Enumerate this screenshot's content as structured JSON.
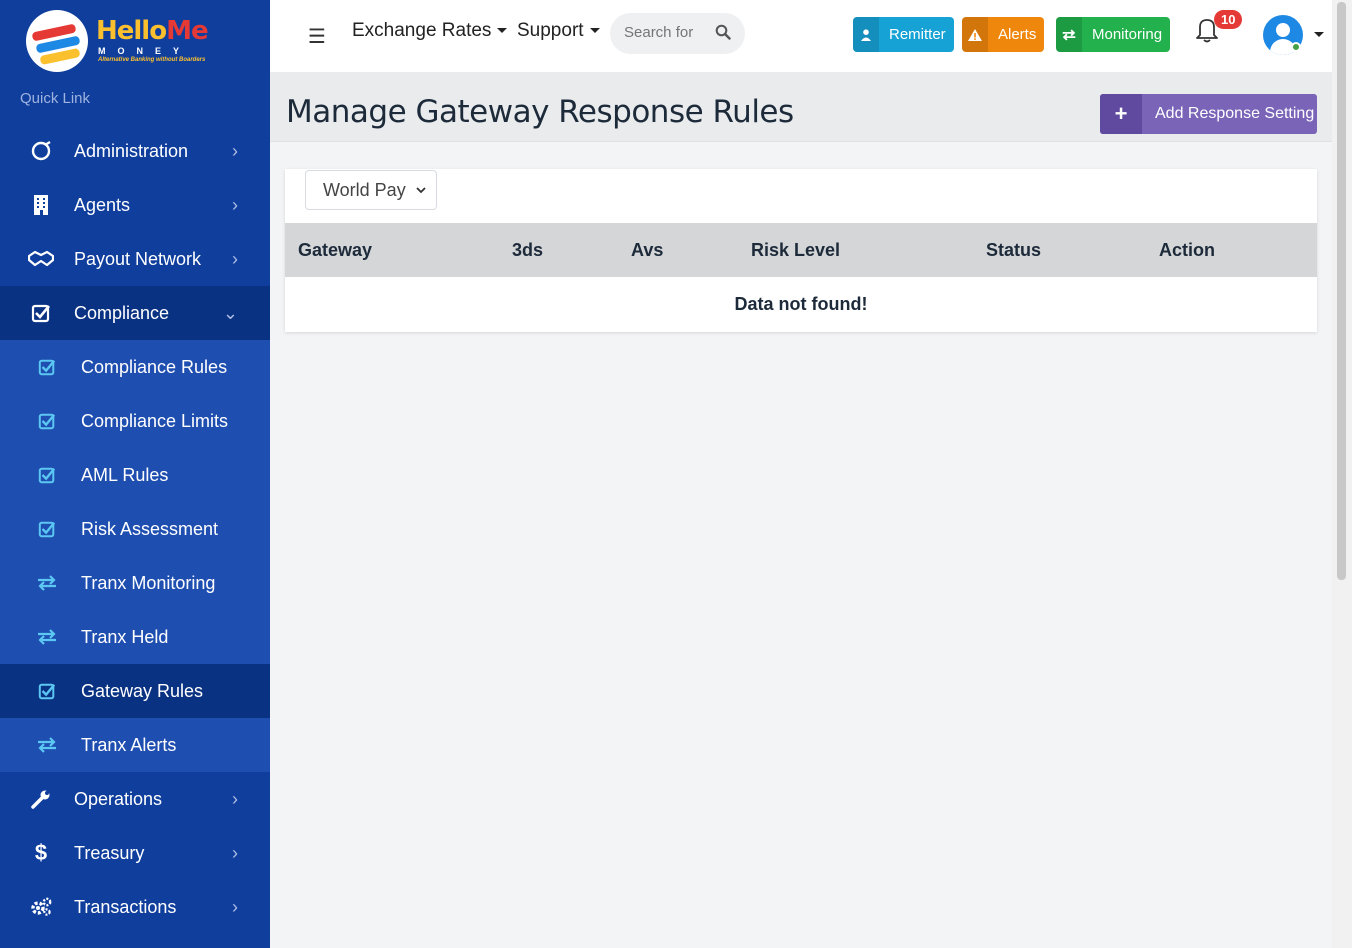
{
  "brand": {
    "hello": "Hello",
    "me": "Me",
    "money": "MONEY",
    "tagline": "Alternative Banking without Boarders"
  },
  "sidebar": {
    "quick_link": "Quick Link",
    "items_top": [
      {
        "label": "Administration",
        "icon": "compass-icon"
      },
      {
        "label": "Agents",
        "icon": "building-icon"
      },
      {
        "label": "Payout Network",
        "icon": "handshake-icon"
      },
      {
        "label": "Compliance",
        "icon": "check-square-icon"
      }
    ],
    "compliance_sub": [
      {
        "label": "Compliance Rules",
        "icon": "check-square-icon"
      },
      {
        "label": "Compliance Limits",
        "icon": "check-square-icon"
      },
      {
        "label": "AML Rules",
        "icon": "check-square-icon"
      },
      {
        "label": "Risk Assessment",
        "icon": "check-square-icon"
      },
      {
        "label": "Tranx Monitoring",
        "icon": "exchange-icon"
      },
      {
        "label": "Tranx Held",
        "icon": "exchange-icon"
      },
      {
        "label": "Gateway Rules",
        "icon": "check-square-icon"
      },
      {
        "label": "Tranx Alerts",
        "icon": "exchange-icon"
      }
    ],
    "items_bottom": [
      {
        "label": "Operations",
        "icon": "wrench-icon"
      },
      {
        "label": "Treasury",
        "icon": "dollar-icon"
      },
      {
        "label": "Transactions",
        "icon": "cogs-icon"
      }
    ]
  },
  "topbar": {
    "menu_exchange": "Exchange Rates",
    "menu_support": "Support",
    "search_placeholder": "Search for",
    "btn_remitter": "Remitter",
    "btn_alerts": "Alerts",
    "btn_monitoring": "Monitoring",
    "notification_count": "10",
    "colors": {
      "remitter": "#17a2d6",
      "alerts": "#f0870d",
      "monitoring": "#22b14c"
    }
  },
  "page": {
    "title": "Manage Gateway Response Rules",
    "add_button": "Add Response Setting",
    "gateway_select": "World Pay",
    "columns": [
      "Gateway",
      "3ds",
      "Avs",
      "Risk Level",
      "Status",
      "Action"
    ],
    "empty_message": "Data not found!"
  }
}
